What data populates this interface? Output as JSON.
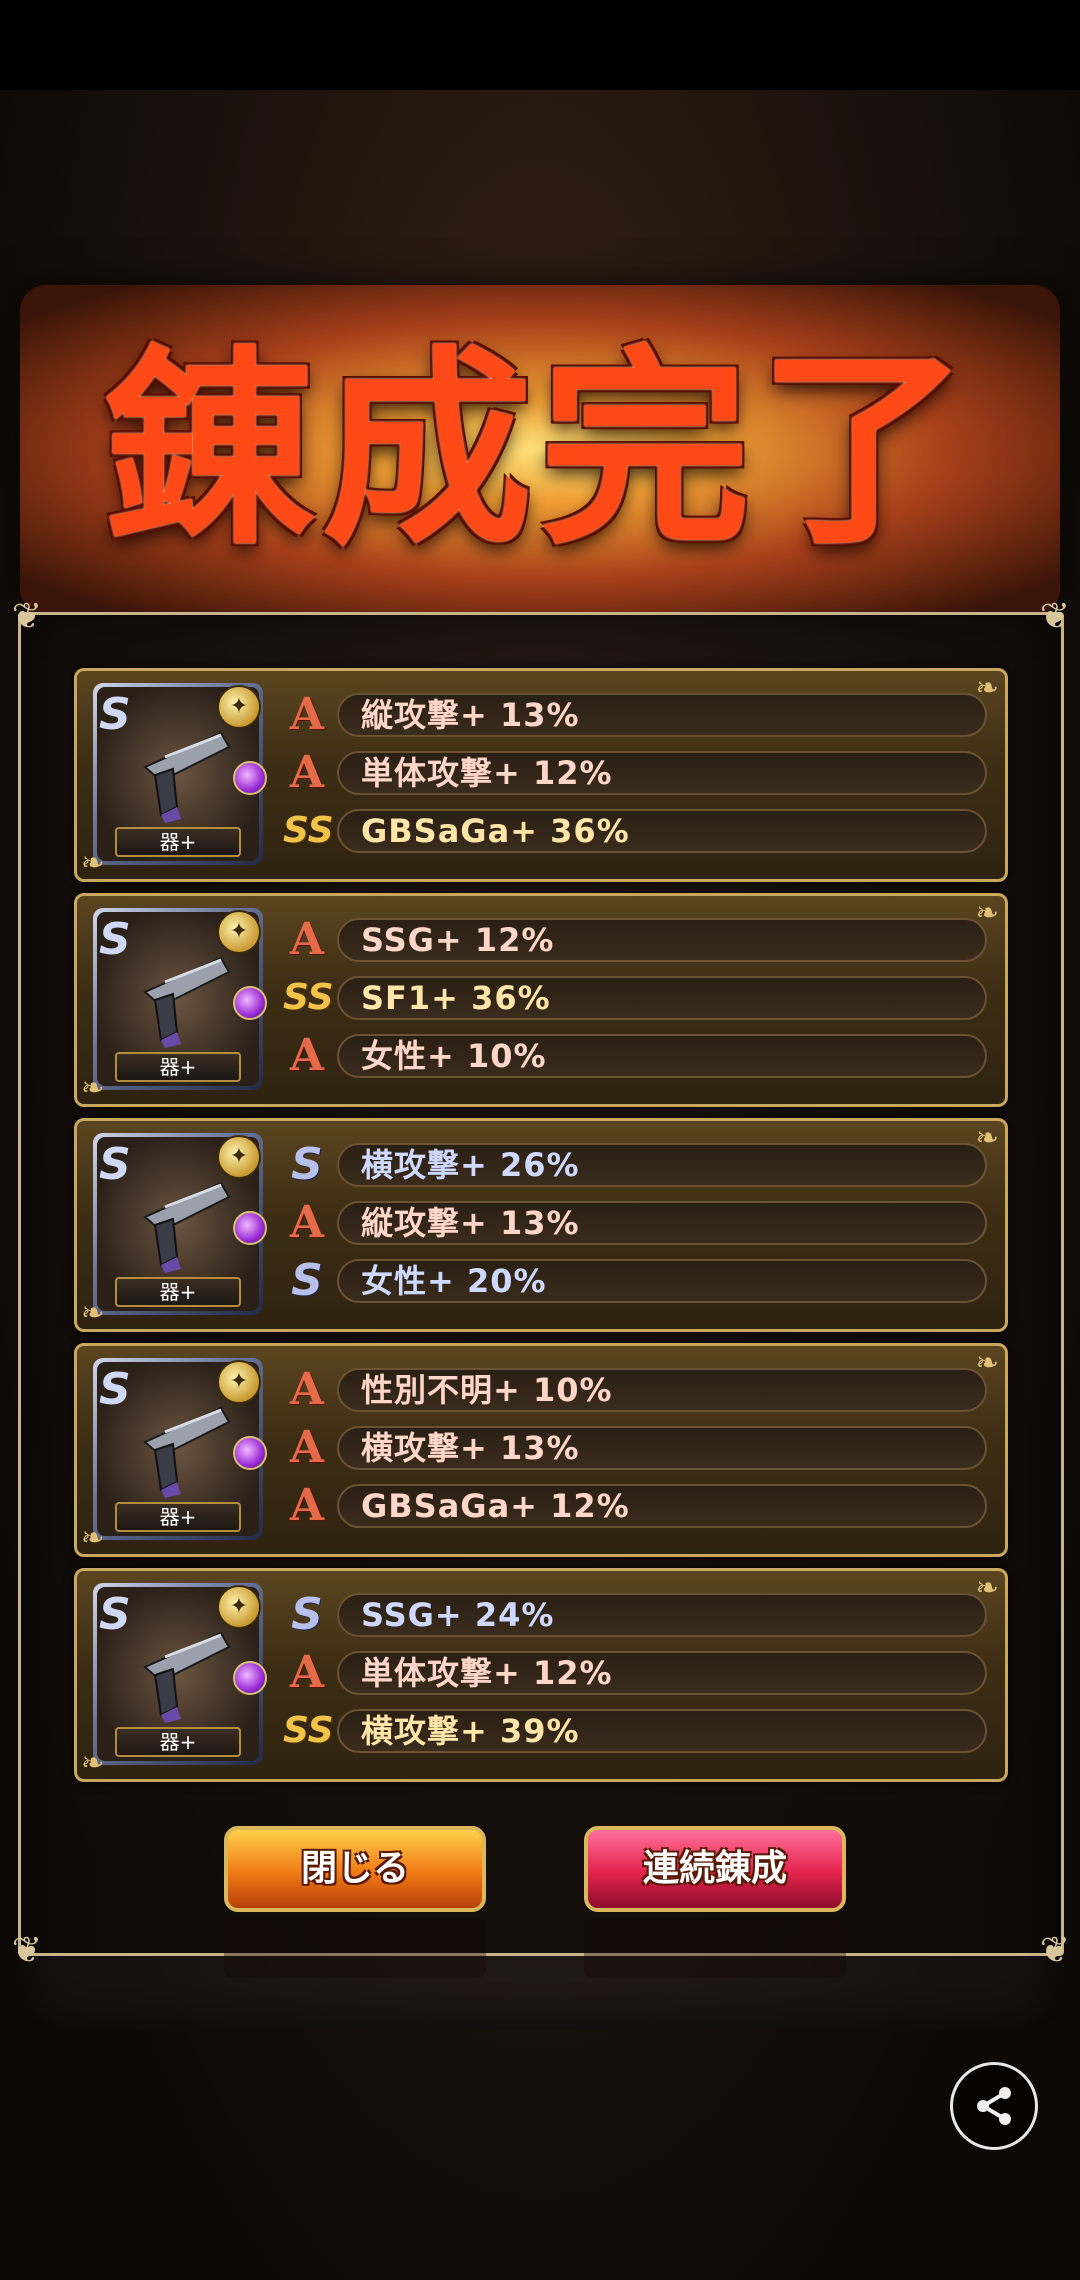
{
  "banner": {
    "title": "錬成完了"
  },
  "results": [
    {
      "badge": "器+",
      "effects": [
        {
          "rank": "A",
          "text": "縦攻撃+ 13%"
        },
        {
          "rank": "A",
          "text": "単体攻撃+ 12%"
        },
        {
          "rank": "SS",
          "text": "GBSaGa+ 36%"
        }
      ]
    },
    {
      "badge": "器+",
      "effects": [
        {
          "rank": "A",
          "text": "SSG+ 12%"
        },
        {
          "rank": "SS",
          "text": "SF1+ 36%"
        },
        {
          "rank": "A",
          "text": "女性+ 10%"
        }
      ]
    },
    {
      "badge": "器+",
      "effects": [
        {
          "rank": "S",
          "text": "横攻撃+ 26%"
        },
        {
          "rank": "A",
          "text": "縦攻撃+ 13%"
        },
        {
          "rank": "S",
          "text": "女性+ 20%"
        }
      ]
    },
    {
      "badge": "器+",
      "effects": [
        {
          "rank": "A",
          "text": "性別不明+ 10%"
        },
        {
          "rank": "A",
          "text": "横攻撃+ 13%"
        },
        {
          "rank": "A",
          "text": "GBSaGa+ 12%"
        }
      ]
    },
    {
      "badge": "器+",
      "effects": [
        {
          "rank": "S",
          "text": "SSG+ 24%"
        },
        {
          "rank": "A",
          "text": "単体攻撃+ 12%"
        },
        {
          "rank": "SS",
          "text": "横攻撃+ 39%"
        }
      ]
    }
  ],
  "buttons": {
    "close": "閉じる",
    "continue": "連続錬成"
  },
  "icons": {
    "share": "share-icon",
    "weapon": "pistol-icon",
    "gem": "purple-gem-icon"
  },
  "colors": {
    "rank_a": "#e56a4a",
    "rank_s": "#b6c0ea",
    "rank_ss": "#f2c24a",
    "frame_gold": "#c9a75c"
  }
}
